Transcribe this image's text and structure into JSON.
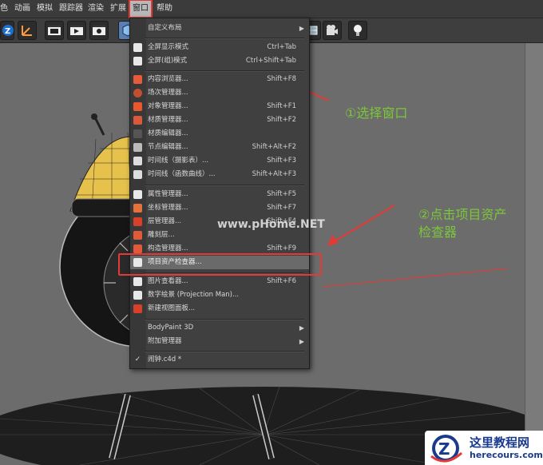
{
  "menubar": {
    "items": [
      {
        "label": "色"
      },
      {
        "label": "动画"
      },
      {
        "label": "模拟"
      },
      {
        "label": "跟踪器"
      },
      {
        "label": "渲染"
      },
      {
        "label": "扩展"
      },
      {
        "label": "窗口"
      },
      {
        "label": "帮助"
      }
    ]
  },
  "menu": {
    "items": [
      {
        "label": "自定义布局",
        "shortcut": "",
        "submenu": true
      },
      {
        "label": "全屏显示模式",
        "shortcut": "Ctrl+Tab"
      },
      {
        "label": "全屏(组)模式",
        "shortcut": "Ctrl+Shift+Tab"
      },
      {
        "label": "内容浏览器...",
        "shortcut": "Shift+F8"
      },
      {
        "label": "场次管理器...",
        "shortcut": ""
      },
      {
        "label": "对象管理器...",
        "shortcut": "Shift+F1"
      },
      {
        "label": "材质管理器...",
        "shortcut": "Shift+F2"
      },
      {
        "label": "材质编辑器...",
        "shortcut": ""
      },
      {
        "label": "节点编辑器...",
        "shortcut": "Shift+Alt+F2"
      },
      {
        "label": "时间线（摄影表）...",
        "shortcut": "Shift+F3"
      },
      {
        "label": "时间线（函数曲线）...",
        "shortcut": "Shift+Alt+F3"
      },
      {
        "label": "属性管理器...",
        "shortcut": "Shift+F5"
      },
      {
        "label": "坐标管理器...",
        "shortcut": "Shift+F7"
      },
      {
        "label": "层管理器...",
        "shortcut": "Shift+F4"
      },
      {
        "label": "雕刻层...",
        "shortcut": ""
      },
      {
        "label": "构造管理器...",
        "shortcut": "Shift+F9"
      },
      {
        "label": "项目资产检查器...",
        "shortcut": ""
      },
      {
        "label": "图片查看器...",
        "shortcut": "Shift+F6"
      },
      {
        "label": "数字绘景 (Projection Man)...",
        "shortcut": ""
      },
      {
        "label": "新建视图面板...",
        "shortcut": ""
      },
      {
        "label": "BodyPaint 3D",
        "shortcut": "",
        "submenu": true
      },
      {
        "label": "附加管理器",
        "shortcut": "",
        "submenu": true
      },
      {
        "label": "闹钟.c4d *",
        "shortcut": ""
      }
    ]
  },
  "annotations": {
    "step1": "①选择窗口",
    "step2_line1": "②点击项目资产",
    "step2_line2": "检查器"
  },
  "watermark": "www.pHome.NET",
  "logo": {
    "title": "这里教程网",
    "url": "herecours.com"
  },
  "colors": {
    "annotation_red": "#e53935",
    "annotation_green": "#7cc63a"
  }
}
